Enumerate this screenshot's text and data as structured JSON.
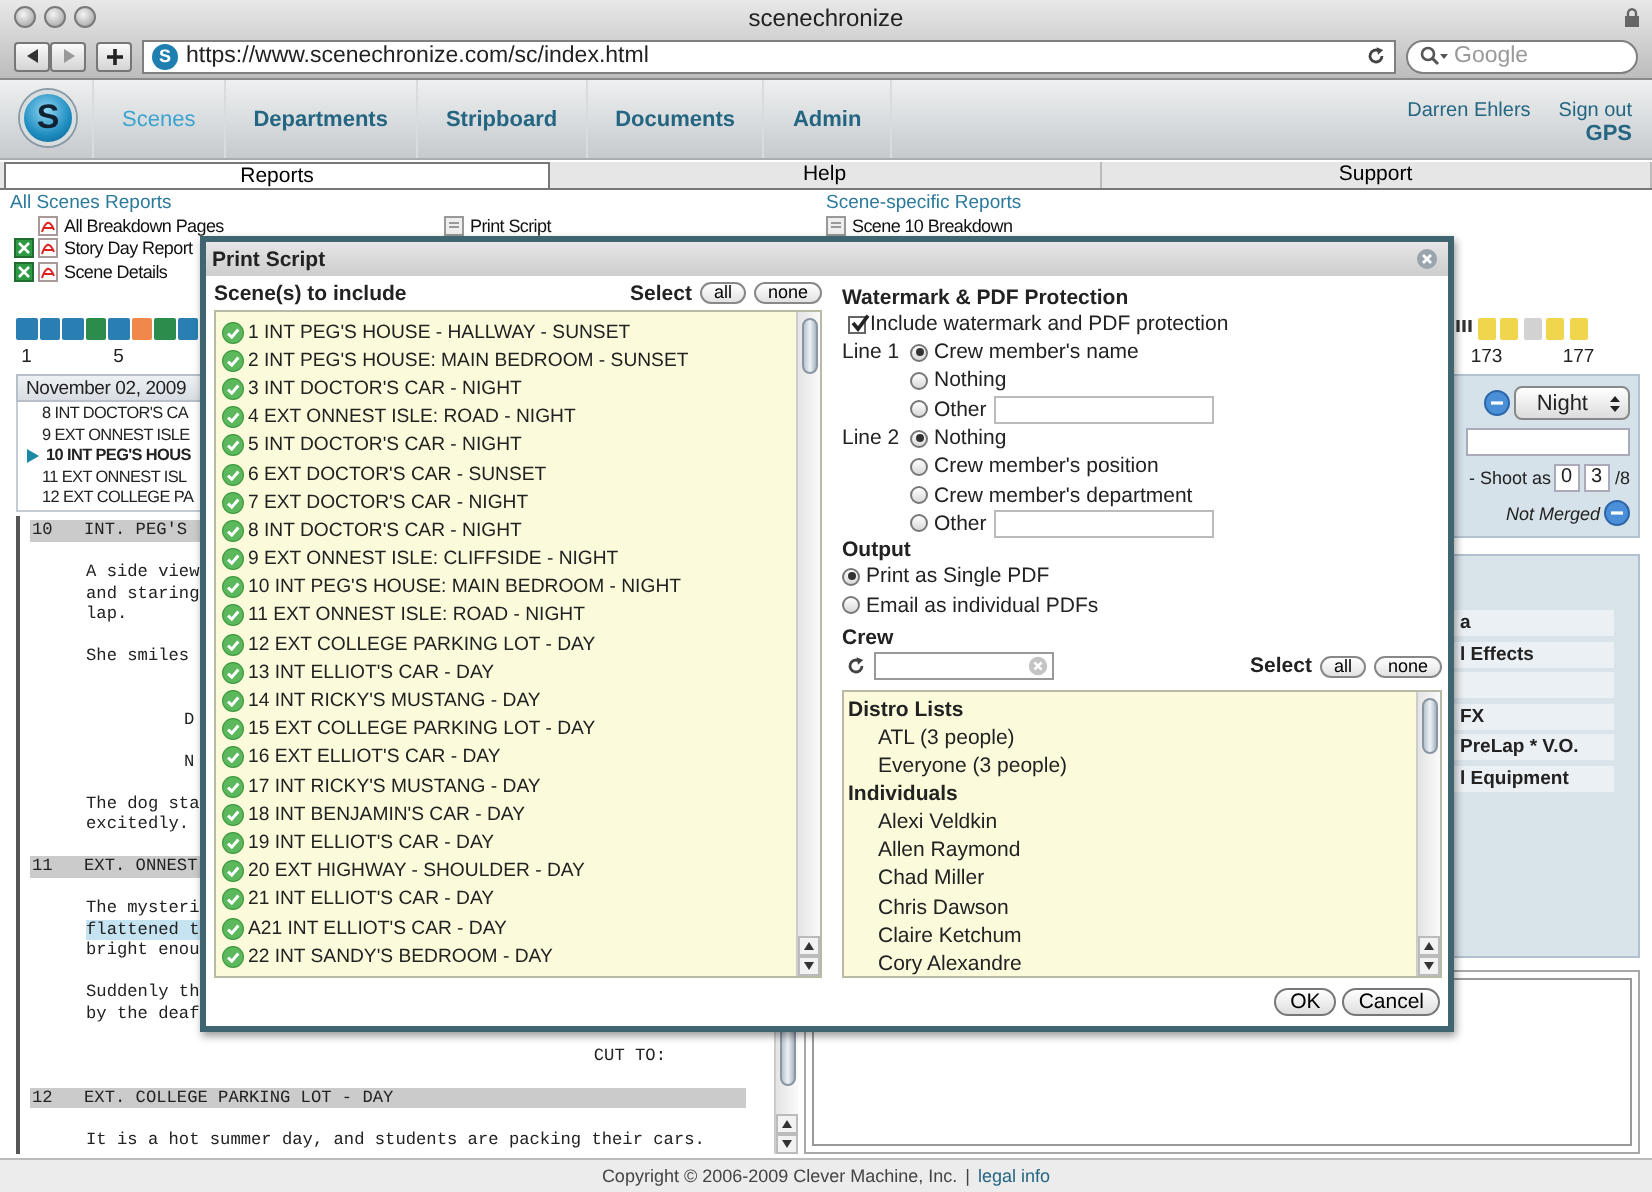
{
  "window": {
    "title": "scenechronize"
  },
  "browser": {
    "favicon_letter": "S",
    "url": "https://www.scenechronize.com/sc/index.html",
    "search": {
      "placeholder": "Google"
    }
  },
  "nav": {
    "logo_letter": "S",
    "tabs": [
      {
        "label": "Scenes",
        "selected": true
      },
      {
        "label": "Departments",
        "selected": false
      },
      {
        "label": "Stripboard",
        "selected": false
      },
      {
        "label": "Documents",
        "selected": false
      },
      {
        "label": "Admin",
        "selected": false
      }
    ],
    "user": "Darren Ehlers",
    "sign_out": "Sign out",
    "project": "GPS"
  },
  "subtabs": [
    {
      "label": "Reports",
      "selected": true
    },
    {
      "label": "Help",
      "selected": false
    },
    {
      "label": "Support",
      "selected": false
    }
  ],
  "reports": {
    "all_heading": "All Scenes Reports",
    "all_items": [
      {
        "label": "All Breakdown Pages",
        "kind": "pdf"
      },
      {
        "label": "Story Day Report",
        "kind": "excel-pdf"
      },
      {
        "label": "Scene Details",
        "kind": "excel-pdf"
      }
    ],
    "middle_items": [
      {
        "label": "Print Script"
      }
    ],
    "specific_heading": "Scene-specific Reports",
    "specific_items": [
      {
        "label": "Scene 10 Breakdown"
      }
    ]
  },
  "stripboard": [
    {
      "color": "#2a7fb2",
      "label": "1"
    },
    {
      "color": "#2a7fb2"
    },
    {
      "color": "#2a7fb2"
    },
    {
      "color": "#2b8c4c"
    },
    {
      "color": "#2a7fb2",
      "label": "5"
    },
    {
      "color": "#f0884c"
    },
    {
      "color": "#2b8c4c"
    },
    {
      "color": "#2a7fb2"
    }
  ],
  "date": "November 02, 2009",
  "scene_list": [
    {
      "label": "8 INT DOCTOR'S CA",
      "selected": false
    },
    {
      "label": "9 EXT ONNEST ISLE",
      "selected": false
    },
    {
      "label": "10 INT PEG'S HOUS",
      "selected": true
    },
    {
      "label": "11 EXT ONNEST ISL",
      "selected": false
    },
    {
      "label": "12 EXT COLLEGE PA",
      "selected": false
    }
  ],
  "script": [
    {
      "kind": "heading",
      "number": "10",
      "text": "INT. PEG'S"
    },
    {
      "kind": "action",
      "lines": [
        {
          "text": "A side view",
          "highlighted": false
        },
        {
          "text": "and staring",
          "highlighted": false
        },
        {
          "text": "lap.",
          "highlighted": false
        }
      ]
    },
    {
      "kind": "action",
      "lines": [
        {
          "text": "She smiles",
          "highlighted": false
        }
      ]
    },
    {
      "kind": "dialogue",
      "lines": [
        {
          "text": "D",
          "highlighted": false
        }
      ]
    },
    {
      "kind": "dialogue",
      "lines": [
        {
          "text": "N",
          "highlighted": false
        }
      ]
    },
    {
      "kind": "action",
      "lines": [
        {
          "text": "The dog sta",
          "highlighted": false
        },
        {
          "text": "excitedly.",
          "highlighted": false
        }
      ]
    },
    {
      "kind": "heading",
      "number": "11",
      "text": "EXT. ONNEST"
    },
    {
      "kind": "action",
      "lines": [
        {
          "text": "The mysteri",
          "highlighted": false
        },
        {
          "text": "flattened t",
          "highlighted": true
        },
        {
          "text": "bright enou",
          "highlighted": false
        }
      ]
    },
    {
      "kind": "action",
      "lines": [
        {
          "text": "Suddenly th",
          "highlighted": false
        },
        {
          "text": "by the deaf",
          "highlighted": false
        }
      ]
    },
    {
      "kind": "transition",
      "lines": [
        {
          "text": "CUT TO:",
          "highlighted": false
        }
      ]
    },
    {
      "kind": "heading",
      "number": "12",
      "text": "EXT. COLLEGE PARKING LOT - DAY"
    },
    {
      "kind": "action",
      "lines": [
        {
          "text": "It is a hot summer day, and students are packing their cars.",
          "highlighted": false
        }
      ]
    }
  ],
  "detail": {
    "strip": [
      {
        "color": "#f0d64c",
        "label": "173"
      },
      {
        "color": "#f0d64c"
      },
      {
        "color": "#d2d2d2"
      },
      {
        "color": "#f0d64c"
      },
      {
        "color": "#f0d64c",
        "label": "177"
      }
    ],
    "time_of_day": "Night",
    "shoot_as_label": "- Shoot as",
    "eighths_whole": "0",
    "eighths_part": "3",
    "eighths_suffix": "/8",
    "merge_status": "Not Merged",
    "elements": [
      {
        "kind": "named",
        "label": "a"
      },
      {
        "kind": "named",
        "label": "l Effects"
      },
      {
        "kind": "blank"
      },
      {
        "kind": "named",
        "label": "FX"
      },
      {
        "kind": "named",
        "label": "PreLap * V.O."
      },
      {
        "kind": "named",
        "label": "l Equipment"
      }
    ]
  },
  "dialog": {
    "title": "Print Script",
    "scenes_heading": "Scene(s) to include",
    "select_label": "Select",
    "all_button": "all",
    "none_button": "none",
    "scenes": [
      {
        "label": "1 INT PEG'S HOUSE - HALLWAY - SUNSET",
        "checked": true
      },
      {
        "label": "2 INT PEG'S HOUSE: MAIN BEDROOM - SUNSET",
        "checked": true
      },
      {
        "label": "3 INT DOCTOR'S CAR - NIGHT",
        "checked": true
      },
      {
        "label": "4 EXT ONNEST ISLE: ROAD - NIGHT",
        "checked": true
      },
      {
        "label": "5 INT DOCTOR'S CAR - NIGHT",
        "checked": true
      },
      {
        "label": "6 EXT DOCTOR'S CAR - SUNSET",
        "checked": true
      },
      {
        "label": "7 EXT DOCTOR'S CAR - NIGHT",
        "checked": true
      },
      {
        "label": "8 INT DOCTOR'S CAR - NIGHT",
        "checked": true
      },
      {
        "label": "9 EXT ONNEST ISLE: CLIFFSIDE - NIGHT",
        "checked": true
      },
      {
        "label": "10 INT PEG'S HOUSE: MAIN BEDROOM - NIGHT",
        "checked": true
      },
      {
        "label": "11 EXT ONNEST ISLE: ROAD - NIGHT",
        "checked": true
      },
      {
        "label": "12 EXT COLLEGE PARKING LOT - DAY",
        "checked": true
      },
      {
        "label": "13 INT ELLIOT'S CAR - DAY",
        "checked": true
      },
      {
        "label": "14 INT RICKY'S MUSTANG - DAY",
        "checked": true
      },
      {
        "label": "15 EXT COLLEGE PARKING LOT - DAY",
        "checked": true
      },
      {
        "label": "16 EXT ELLIOT'S CAR - DAY",
        "checked": true
      },
      {
        "label": "17 INT RICKY'S MUSTANG - DAY",
        "checked": true
      },
      {
        "label": "18 INT BENJAMIN'S CAR - DAY",
        "checked": true
      },
      {
        "label": "19 INT ELLIOT'S CAR - DAY",
        "checked": true
      },
      {
        "label": "20 EXT HIGHWAY - SHOULDER - DAY",
        "checked": true
      },
      {
        "label": "21 INT ELLIOT'S CAR - DAY",
        "checked": true
      },
      {
        "label": "A21 INT ELLIOT'S CAR - DAY",
        "checked": true
      },
      {
        "label": "22 INT SANDY'S BEDROOM - DAY",
        "checked": true
      }
    ],
    "watermark": {
      "heading": "Watermark & PDF Protection",
      "include": {
        "label": "Include watermark and PDF protection",
        "checked": true
      },
      "lines": [
        {
          "label": "Line 1",
          "options": [
            {
              "label": "Crew member's name",
              "selected": true,
              "kind": "plain"
            },
            {
              "label": "Nothing",
              "selected": false,
              "kind": "plain"
            },
            {
              "label": "Other",
              "selected": false,
              "kind": "text"
            }
          ]
        },
        {
          "label": "Line 2",
          "options": [
            {
              "label": "Nothing",
              "selected": true,
              "kind": "plain"
            },
            {
              "label": "Crew member's position",
              "selected": false,
              "kind": "plain"
            },
            {
              "label": "Crew member's department",
              "selected": false,
              "kind": "plain"
            },
            {
              "label": "Other",
              "selected": false,
              "kind": "text"
            }
          ]
        }
      ]
    },
    "output": {
      "heading": "Output",
      "options": [
        {
          "label": "Print as Single PDF",
          "selected": true
        },
        {
          "label": "Email as individual PDFs",
          "selected": false
        }
      ]
    },
    "crew": {
      "heading": "Crew",
      "select_label": "Select",
      "all_button": "all",
      "none_button": "none",
      "groups": [
        {
          "label": "Distro Lists",
          "children": [
            {
              "label": "ATL (3 people)"
            },
            {
              "label": "Everyone (3 people)"
            }
          ]
        },
        {
          "label": "Individuals",
          "children": [
            {
              "label": "Alexi Veldkin"
            },
            {
              "label": "Allen Raymond"
            },
            {
              "label": "Chad Miller"
            },
            {
              "label": "Chris Dawson"
            },
            {
              "label": "Claire Ketchum"
            },
            {
              "label": "Cory Alexandre"
            }
          ]
        }
      ]
    },
    "ok_button": "OK",
    "cancel_button": "Cancel"
  },
  "footer": {
    "copyright": "Copyright © 2006-2009 Clever Machine, Inc.",
    "separator": "|",
    "link": "legal info"
  }
}
